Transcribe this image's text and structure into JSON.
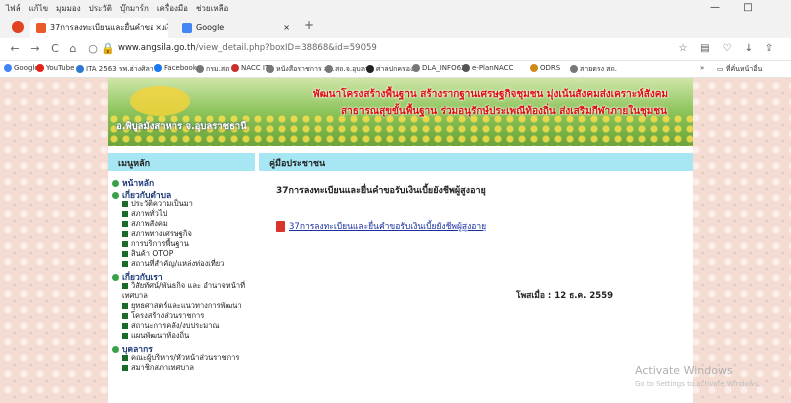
{
  "browser_menu": [
    "ไฟล์",
    "แก้ไข",
    "มุมมอง",
    "ประวัติ",
    "บุ๊กมาร์ก",
    "เครื่องมือ",
    "ช่วยเหลือ"
  ],
  "window": {
    "minimize": "—",
    "maximize": "□"
  },
  "tabs": [
    {
      "title": "37การลงทะเบียนและยื่นคำขอรับเงินเบี้ยยังชีพผู้สูงอายุ",
      "close": "×",
      "icon_color": "#e85a2a"
    },
    {
      "title": "Google",
      "close": "×",
      "icon_color": "#4285f4"
    }
  ],
  "new_tab": "+",
  "nav": {
    "back": "←",
    "forward": "→",
    "reload": "C",
    "home": "⌂",
    "url_host": "www.angsila.go.th",
    "url_path": "/view_detail.php?boxID=38868&id=59059"
  },
  "bookmarks": [
    {
      "label": "Google",
      "color": "#4285f4"
    },
    {
      "label": "YouTube",
      "color": "#e62117"
    },
    {
      "label": "ITA 2563 รพ.ฮ่างศิลา",
      "color": "#2a7ad1"
    },
    {
      "label": "Facebook",
      "color": "#1877f2"
    },
    {
      "label": "กรม.สถ",
      "color": "#777777"
    },
    {
      "label": "NACC ITA",
      "color": "#c9302c"
    },
    {
      "label": "หนังสือราชการ สถ.",
      "color": "#777777"
    },
    {
      "label": "สถ.จ.อุบลฯ",
      "color": "#777777"
    },
    {
      "label": "ศาลปกครอง",
      "color": "#222222"
    },
    {
      "label": "DLA_INFO62",
      "color": "#777777"
    },
    {
      "label": "e-PlanNACC",
      "color": "#555555"
    },
    {
      "label": "ODRS",
      "color": "#d08a1a"
    },
    {
      "label": "สายตรง สถ.",
      "color": "#777777"
    }
  ],
  "bookmarks_overflow": "»",
  "bookmarks_other": "ที่คั่นหน้าอื่น",
  "banner": {
    "line1": "พัฒนาโครงสร้างพื้นฐาน  สร้างรากฐานเศรษฐกิจชุมชน  มุ่งเน้นสังคมส่งเคราะห์สังคม",
    "line2": "สาธารณสุขขั้นพื้นฐาน  ร่วมอนุรักษ์ประเพณีท้องถิ่น  ส่งเสริมกีฬาภายในชุมชน",
    "org": "อ.พิบูลมังสาหาร  จ.อุบลราชธานี"
  },
  "sidebar": {
    "title": "เมนูหลัก",
    "sections": [
      {
        "label": "หน้าหลัก",
        "items": []
      },
      {
        "label": "เกี่ยวกับตำบล",
        "items": [
          "ประวัติความเป็นมา",
          "สภาพทั่วไป",
          "สภาพสังคม",
          "สภาพทางเศรษฐกิจ",
          "การบริการพื้นฐาน",
          "สินค้า OTOP",
          "สถานที่สำคัญ/แหล่งท่องเที่ยว"
        ]
      },
      {
        "label": "เกี่ยวกับเรา",
        "items": [
          "วิสัยทัศน์/พันธกิจ และ อำนาจหน้าที่เทศบาล",
          "ยุทธศาสตร์และแนวทางการพัฒนา",
          "โครงสร้างส่วนราชการ",
          "สถานะการคลัง/งบประมาณ",
          "แผนพัฒนาท้องถิ่น"
        ]
      },
      {
        "label": "บุคลากร",
        "items": [
          "คณะผู้บริหาร/หัวหน้าส่วนราชการ",
          "สมาชิกสภาเทศบาล"
        ]
      }
    ]
  },
  "main": {
    "header": "คู่มือประชาชน",
    "title": "37การลงทะเบียนและยื่นคำขอรับเงินเบี้ยยังชีพผู้สูงอายุ",
    "attachment": "37การลงทะเบียนและยื่นคำขอรับเงินเบี้ยยังชีพผู้สูงอายุ",
    "posted": "โพสเมื่อ : 12 ธ.ค. 2559"
  },
  "watermark": {
    "line1": "Activate Windows",
    "line2": "Go to Settings to activate Windows."
  }
}
